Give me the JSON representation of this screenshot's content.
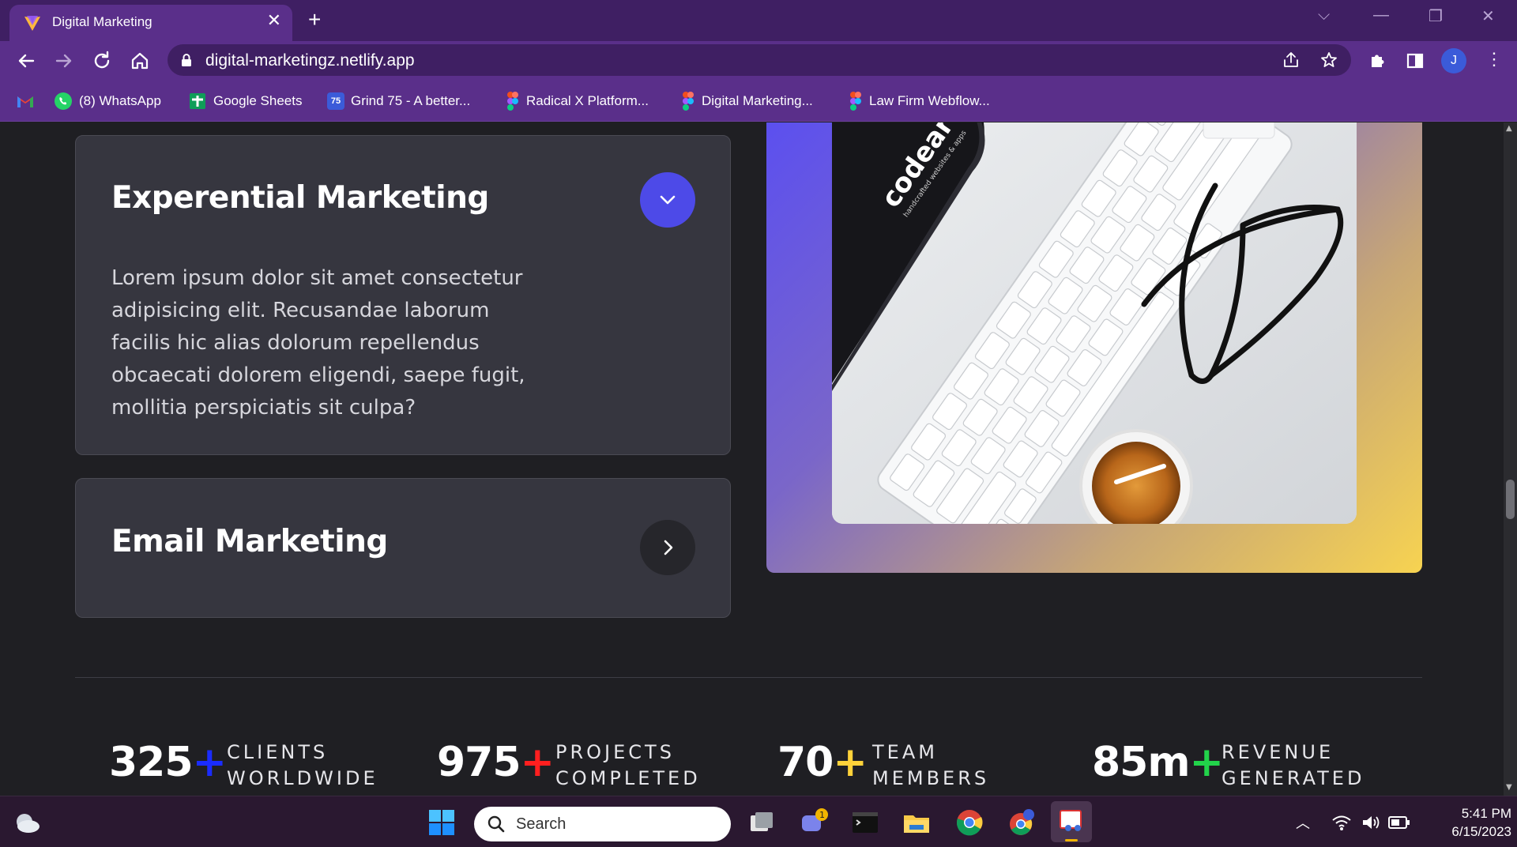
{
  "browser": {
    "tab_title": "Digital Marketing",
    "url": "digital-marketingz.netlify.app",
    "profile_initial": "J"
  },
  "bookmarks": [
    {
      "label": "",
      "icon": "gmail-icon"
    },
    {
      "label": "(8) WhatsApp",
      "icon": "whatsapp-icon"
    },
    {
      "label": "Google Sheets",
      "icon": "google-sheets-icon"
    },
    {
      "label": "Grind 75 - A better...",
      "icon": "grind75-icon"
    },
    {
      "label": "Radical X Platform...",
      "icon": "figma-icon"
    },
    {
      "label": "Digital Marketing...",
      "icon": "figma-icon"
    },
    {
      "label": "Law Firm Webflow...",
      "icon": "figma-icon"
    }
  ],
  "accordion": [
    {
      "title": "Experential Marketing",
      "body": "Lorem ipsum dolor sit amet consectetur adipisicing elit. Recusandae laborum facilis hic alias dolorum repellendus obcaecati dolorem eligendi, saepe fugit, mollitia perspiciatis sit culpa?",
      "expanded": true
    },
    {
      "title": "Email Marketing",
      "expanded": false
    }
  ],
  "image": {
    "sticker_text": "codeart",
    "sticker_subtext": "handcrafted websites & apps"
  },
  "stats": [
    {
      "value": "325",
      "plus": "+",
      "plus_color": "#1a2cff",
      "label_line1": "CLIENTS",
      "label_line2": "WORLDWIDE"
    },
    {
      "value": "975",
      "plus": "+",
      "plus_color": "#ff1f1f",
      "label_line1": "PROJECTS",
      "label_line2": "COMPLETED"
    },
    {
      "value": "70",
      "plus": "+",
      "plus_color": "#ffd23a",
      "label_line1": "TEAM",
      "label_line2": "MEMBERS"
    },
    {
      "value": "85m",
      "plus": "+",
      "plus_color": "#22d34a",
      "label_line1": "REVENUE",
      "label_line2": "GENERATED"
    }
  ],
  "taskbar": {
    "search_placeholder": "Search",
    "time": "5:41 PM",
    "date": "6/15/2023",
    "teams_badge": "1"
  },
  "colors": {
    "accent_purple": "#5a2f8a",
    "button_blue": "#4d4ae8",
    "page_bg": "#1f1f23",
    "card_bg": "#36363f"
  }
}
